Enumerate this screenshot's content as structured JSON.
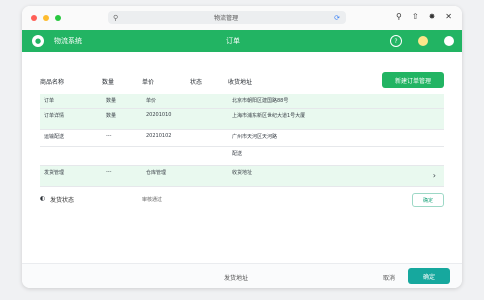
{
  "colors": {
    "green": "#22b463",
    "green_light": "#e9f9ef",
    "teal": "#16a89e",
    "red": "#ff5f57",
    "yellow": "#febc2e",
    "traffic_green": "#28c840"
  },
  "browser": {
    "url": "物流管理",
    "search_icon": "search-icon",
    "reload_icon": "reload-icon"
  },
  "app": {
    "name": "物流系统",
    "title": "订单"
  },
  "table": {
    "headers": [
      "商品名称",
      "数量",
      "单价",
      "状态",
      "收货地址"
    ],
    "primary_button": "新建订单管理",
    "rows": [
      {
        "name": "订单",
        "qty": "数量",
        "price": "单价",
        "address": "北京市朝阳区建国路88号",
        "highlight": true
      },
      {
        "name": "订单详情",
        "qty": "数量",
        "price": "20201010",
        "address": "上海市浦东新区世纪大道1号大厦",
        "highlight": true
      },
      {
        "name": "运输配送",
        "qty": "---",
        "price": "20210102",
        "address": "广州市天河区天河路",
        "highlight": false
      },
      {
        "name": "",
        "qty": "",
        "price": "",
        "address": "配送",
        "highlight": false
      },
      {
        "name": "发货管理",
        "qty": "---",
        "price": "仓库管理",
        "address": "收货地址",
        "highlight": true,
        "chevron": "›"
      }
    ]
  },
  "status": {
    "label": "发货状态",
    "value": "审核通过",
    "button": "确定"
  },
  "footer": {
    "label": "发货地址",
    "cancel": "取消",
    "confirm": "确定"
  }
}
